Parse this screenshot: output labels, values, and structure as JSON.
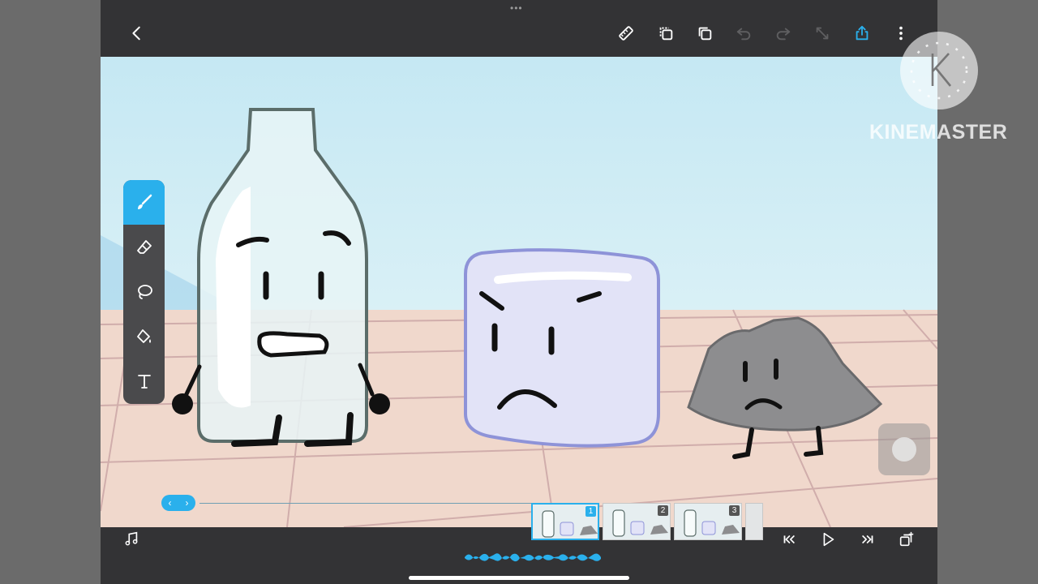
{
  "topbar": {
    "buttons": [
      {
        "name": "back-button",
        "icon": "chevron-left-icon"
      },
      {
        "name": "ruler-button",
        "icon": "ruler-icon"
      },
      {
        "name": "duplicate-button",
        "icon": "copy-icon"
      },
      {
        "name": "layers-button",
        "icon": "layers-icon"
      },
      {
        "name": "undo-button",
        "icon": "undo-icon"
      },
      {
        "name": "redo-button",
        "icon": "redo-icon"
      },
      {
        "name": "resize-button",
        "icon": "resize-icon"
      },
      {
        "name": "export-button",
        "icon": "share-icon"
      },
      {
        "name": "more-button",
        "icon": "more-vertical-icon"
      }
    ]
  },
  "tools": [
    {
      "name": "brush",
      "icon": "brush-icon",
      "active": true
    },
    {
      "name": "eraser",
      "icon": "eraser-icon",
      "active": false
    },
    {
      "name": "lasso",
      "icon": "lasso-icon",
      "active": false
    },
    {
      "name": "fill",
      "icon": "paint-bucket-icon",
      "active": false
    },
    {
      "name": "text",
      "icon": "text-icon",
      "active": false
    }
  ],
  "scrubber": {
    "left": "‹",
    "right": "›"
  },
  "frames": [
    {
      "number": "1",
      "selected": true
    },
    {
      "number": "2",
      "selected": false
    },
    {
      "number": "3",
      "selected": false
    }
  ],
  "watermark": {
    "text": "KINEMASTER"
  },
  "colors": {
    "accent": "#2ab0ec",
    "toolbar": "#333335",
    "sky": "#cdebf3",
    "floor": "#f0d8cc"
  }
}
